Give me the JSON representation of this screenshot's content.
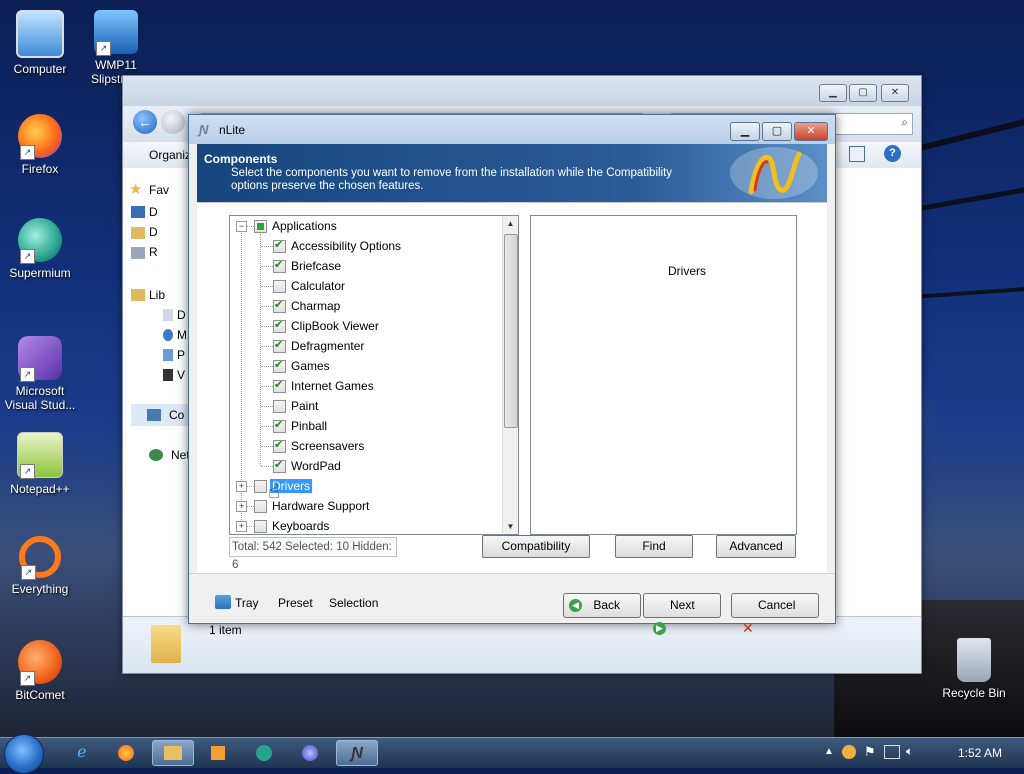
{
  "desktop": {
    "icons": [
      {
        "label": "Computer",
        "icon": "computer-icon"
      },
      {
        "label": "WMP11 Slipstre...",
        "icon": "wmp-slipstreamer-icon"
      },
      {
        "label": "Firefox",
        "icon": "firefox-icon"
      },
      {
        "label": "Supermium",
        "icon": "supermium-icon"
      },
      {
        "label": "Microsoft Visual Stud...",
        "icon": "visual-studio-icon"
      },
      {
        "label": "Notepad++",
        "icon": "notepadpp-icon"
      },
      {
        "label": "Everything",
        "icon": "everything-icon"
      },
      {
        "label": "BitComet",
        "icon": "bitcomet-icon"
      },
      {
        "label": "Recycle Bin",
        "icon": "recycle-bin-icon"
      }
    ]
  },
  "explorer": {
    "toolbar_label": "Organiz",
    "nav_items": [
      "Fav",
      "D",
      "D",
      "R",
      "Lib",
      "D",
      "M",
      "P",
      "V",
      "Co",
      "Net"
    ],
    "details_text": "1 item"
  },
  "nlite": {
    "title": "nLite",
    "header_title": "Components",
    "header_desc": "Select the components you want to remove from the installation while the Compatibility options preserve the chosen features.",
    "tree": [
      {
        "label": "Applications",
        "level": 0,
        "state": "partial",
        "expander": "−"
      },
      {
        "label": "Accessibility Options",
        "level": 1,
        "state": "checked"
      },
      {
        "label": "Briefcase",
        "level": 1,
        "state": "checked"
      },
      {
        "label": "Calculator",
        "level": 1,
        "state": "unchecked"
      },
      {
        "label": "Charmap",
        "level": 1,
        "state": "checked"
      },
      {
        "label": "ClipBook Viewer",
        "level": 1,
        "state": "checked"
      },
      {
        "label": "Defragmenter",
        "level": 1,
        "state": "checked"
      },
      {
        "label": "Games",
        "level": 1,
        "state": "checked"
      },
      {
        "label": "Internet Games",
        "level": 1,
        "state": "checked"
      },
      {
        "label": "Paint",
        "level": 1,
        "state": "unchecked"
      },
      {
        "label": "Pinball",
        "level": 1,
        "state": "checked"
      },
      {
        "label": "Screensavers",
        "level": 1,
        "state": "checked"
      },
      {
        "label": "WordPad",
        "level": 1,
        "state": "checked"
      },
      {
        "label": "Drivers",
        "level": 0,
        "state": "unchecked",
        "expander": "+",
        "selected": true
      },
      {
        "label": "Hardware Support",
        "level": 0,
        "state": "unchecked",
        "expander": "+"
      },
      {
        "label": "Keyboards",
        "level": 0,
        "state": "unchecked",
        "expander": "+"
      }
    ],
    "info_caption": "Drivers",
    "status": "Total: 542 Selected: 10 Hidden: 6",
    "buttons": {
      "compatibility": "Compatibility",
      "find": "Find",
      "advanced": "Advanced",
      "tray": "Tray",
      "preset": "Preset",
      "selection": "Selection",
      "back": "Back",
      "next": "Next",
      "cancel": "Cancel"
    }
  },
  "taskbar": {
    "clock": "1:52 AM",
    "apps": [
      "internet-explorer-icon",
      "firefox-icon",
      "explorer-icon",
      "media-player-icon",
      "supermium-icon",
      "firefox-alt-icon",
      "nlite-icon"
    ]
  }
}
